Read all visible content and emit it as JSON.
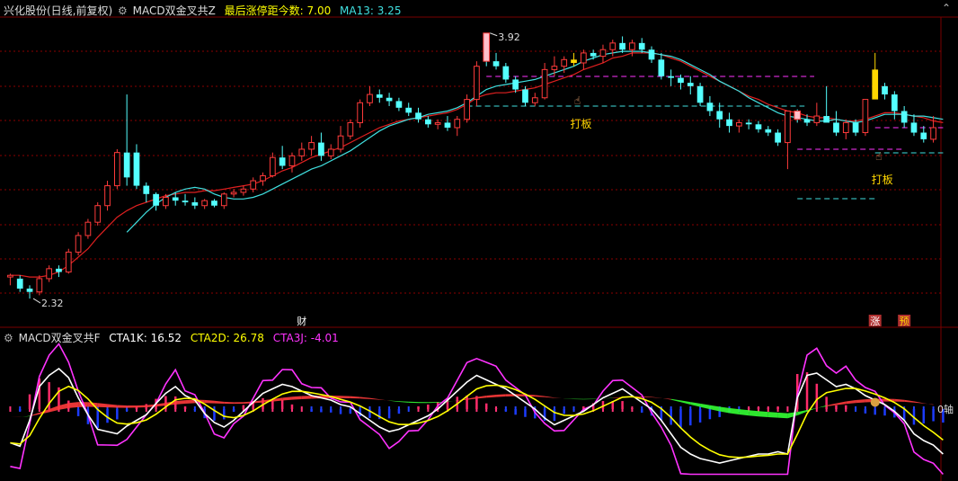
{
  "colors": {
    "up": "#ff3b3b",
    "down": "#54ffff",
    "limit_up": "#ffd700",
    "limit_fill": "#ffc0cb",
    "ma_red": "#e02020",
    "ma_cyan": "#40e0e0",
    "grid": "#8b0000",
    "magenta": "#ff33ff",
    "white": "#ffffff",
    "yellow": "#ffff00",
    "green": "#33ff33",
    "blue": "#1c3cff",
    "label": "#dddddd"
  },
  "header": {
    "stock": "兴化股份(日线,前复权)",
    "indicator": "MACD双金叉共Z",
    "info_label": "最后涨停距今数: 7.00",
    "ma_label": "MA13: 3.25"
  },
  "price_panel": {
    "high_label": "3.92",
    "low_label": "2.32",
    "annotations": [
      "打板",
      "打板"
    ],
    "markers": [
      "财",
      "涨",
      "预"
    ],
    "icons": [
      "hand-pointer-icon",
      "hand-pointer-icon",
      "up-arrow-icon"
    ]
  },
  "macd_header": {
    "name": "MACD双金叉共F",
    "cta1k": "CTA1K: 16.52",
    "cta2d": "CTA2D: 26.78",
    "cta3j": "CTA3J: -4.01",
    "zero_label": "0轴"
  },
  "chart_data": {
    "type": "candlestick",
    "ohlc": [
      [
        2.45,
        2.47,
        2.4,
        2.46
      ],
      [
        2.44,
        2.46,
        2.36,
        2.38
      ],
      [
        2.38,
        2.4,
        2.32,
        2.36
      ],
      [
        2.36,
        2.46,
        2.34,
        2.44
      ],
      [
        2.44,
        2.52,
        2.42,
        2.5
      ],
      [
        2.5,
        2.52,
        2.45,
        2.48
      ],
      [
        2.48,
        2.62,
        2.47,
        2.6
      ],
      [
        2.6,
        2.72,
        2.58,
        2.7
      ],
      [
        2.7,
        2.8,
        2.68,
        2.78
      ],
      [
        2.78,
        2.9,
        2.76,
        2.88
      ],
      [
        2.88,
        3.03,
        2.85,
        3.0
      ],
      [
        3.0,
        3.22,
        2.98,
        3.2
      ],
      [
        3.2,
        3.55,
        3.0,
        3.05
      ],
      [
        3.2,
        3.25,
        2.98,
        3.0
      ],
      [
        3.0,
        3.02,
        2.9,
        2.95
      ],
      [
        2.95,
        2.96,
        2.85,
        2.88
      ],
      [
        2.88,
        2.95,
        2.86,
        2.93
      ],
      [
        2.93,
        2.96,
        2.88,
        2.91
      ],
      [
        2.91,
        2.95,
        2.88,
        2.9
      ],
      [
        2.9,
        2.93,
        2.86,
        2.88
      ],
      [
        2.88,
        2.92,
        2.86,
        2.91
      ],
      [
        2.91,
        2.92,
        2.87,
        2.88
      ],
      [
        2.88,
        2.96,
        2.86,
        2.95
      ],
      [
        2.95,
        2.98,
        2.93,
        2.96
      ],
      [
        2.96,
        3.0,
        2.94,
        2.98
      ],
      [
        2.98,
        3.05,
        2.96,
        3.03
      ],
      [
        3.03,
        3.08,
        3.0,
        3.06
      ],
      [
        3.06,
        3.2,
        3.05,
        3.17
      ],
      [
        3.17,
        3.24,
        3.1,
        3.12
      ],
      [
        3.12,
        3.2,
        3.08,
        3.18
      ],
      [
        3.18,
        3.26,
        3.15,
        3.22
      ],
      [
        3.22,
        3.3,
        3.18,
        3.26
      ],
      [
        3.26,
        3.32,
        3.15,
        3.18
      ],
      [
        3.18,
        3.25,
        3.16,
        3.22
      ],
      [
        3.22,
        3.36,
        3.2,
        3.3
      ],
      [
        3.3,
        3.4,
        3.28,
        3.38
      ],
      [
        3.38,
        3.52,
        3.35,
        3.5
      ],
      [
        3.5,
        3.6,
        3.48,
        3.55
      ],
      [
        3.55,
        3.58,
        3.5,
        3.53
      ],
      [
        3.53,
        3.56,
        3.48,
        3.51
      ],
      [
        3.51,
        3.53,
        3.45,
        3.47
      ],
      [
        3.47,
        3.5,
        3.42,
        3.44
      ],
      [
        3.44,
        3.47,
        3.38,
        3.4
      ],
      [
        3.4,
        3.42,
        3.35,
        3.37
      ],
      [
        3.37,
        3.4,
        3.34,
        3.38
      ],
      [
        3.38,
        3.42,
        3.33,
        3.35
      ],
      [
        3.35,
        3.42,
        3.3,
        3.4
      ],
      [
        3.4,
        3.55,
        3.38,
        3.52
      ],
      [
        3.52,
        3.75,
        3.48,
        3.72
      ],
      [
        3.92,
        3.92,
        3.72,
        3.75
      ],
      [
        3.75,
        3.8,
        3.7,
        3.72
      ],
      [
        3.72,
        3.74,
        3.62,
        3.64
      ],
      [
        3.64,
        3.66,
        3.56,
        3.58
      ],
      [
        3.58,
        3.6,
        3.48,
        3.5
      ],
      [
        3.5,
        3.56,
        3.48,
        3.53
      ],
      [
        3.53,
        3.74,
        3.52,
        3.7
      ],
      [
        3.7,
        3.78,
        3.66,
        3.72
      ],
      [
        3.72,
        3.78,
        3.68,
        3.76
      ],
      [
        3.76,
        3.8,
        3.72,
        3.74
      ],
      [
        3.74,
        3.82,
        3.7,
        3.8
      ],
      [
        3.8,
        3.82,
        3.76,
        3.78
      ],
      [
        3.78,
        3.85,
        3.74,
        3.82
      ],
      [
        3.82,
        3.88,
        3.78,
        3.86
      ],
      [
        3.86,
        3.9,
        3.8,
        3.82
      ],
      [
        3.82,
        3.88,
        3.78,
        3.86
      ],
      [
        3.86,
        3.89,
        3.8,
        3.82
      ],
      [
        3.82,
        3.84,
        3.74,
        3.76
      ],
      [
        3.76,
        3.8,
        3.64,
        3.66
      ],
      [
        3.66,
        3.7,
        3.6,
        3.65
      ],
      [
        3.65,
        3.67,
        3.58,
        3.62
      ],
      [
        3.62,
        3.66,
        3.55,
        3.6
      ],
      [
        3.6,
        3.62,
        3.48,
        3.5
      ],
      [
        3.5,
        3.54,
        3.42,
        3.45
      ],
      [
        3.45,
        3.5,
        3.35,
        3.4
      ],
      [
        3.4,
        3.44,
        3.32,
        3.36
      ],
      [
        3.36,
        3.4,
        3.32,
        3.38
      ],
      [
        3.38,
        3.4,
        3.34,
        3.37
      ],
      [
        3.37,
        3.39,
        3.32,
        3.34
      ],
      [
        3.34,
        3.36,
        3.3,
        3.32
      ],
      [
        3.32,
        3.34,
        3.24,
        3.26
      ],
      [
        3.26,
        3.45,
        3.1,
        3.45
      ],
      [
        3.45,
        3.46,
        3.38,
        3.4
      ],
      [
        3.4,
        3.43,
        3.36,
        3.38
      ],
      [
        3.38,
        3.5,
        3.36,
        3.42
      ],
      [
        3.42,
        3.6,
        3.4,
        3.38
      ],
      [
        3.38,
        3.45,
        3.3,
        3.32
      ],
      [
        3.32,
        3.4,
        3.28,
        3.38
      ],
      [
        3.38,
        3.4,
        3.3,
        3.32
      ],
      [
        3.32,
        3.52,
        3.3,
        3.52
      ],
      [
        3.52,
        3.8,
        3.6,
        3.7
      ],
      [
        3.6,
        3.62,
        3.52,
        3.55
      ],
      [
        3.55,
        3.57,
        3.4,
        3.45
      ],
      [
        3.45,
        3.48,
        3.35,
        3.38
      ],
      [
        3.38,
        3.43,
        3.3,
        3.32
      ],
      [
        3.32,
        3.36,
        3.26,
        3.28
      ],
      [
        3.28,
        3.42,
        3.26,
        3.35
      ]
    ],
    "ma_red": [
      2.46,
      2.46,
      2.45,
      2.45,
      2.46,
      2.48,
      2.52,
      2.57,
      2.62,
      2.69,
      2.75,
      2.81,
      2.85,
      2.88,
      2.9,
      2.92,
      2.94,
      2.95,
      2.96,
      2.96,
      2.97,
      2.97,
      2.98,
      2.99,
      3.0,
      3.01,
      3.03,
      3.06,
      3.09,
      3.11,
      3.14,
      3.17,
      3.19,
      3.21,
      3.23,
      3.26,
      3.29,
      3.32,
      3.35,
      3.37,
      3.39,
      3.4,
      3.41,
      3.42,
      3.43,
      3.44,
      3.46,
      3.49,
      3.53,
      3.55,
      3.56,
      3.56,
      3.57,
      3.58,
      3.59,
      3.61,
      3.63,
      3.65,
      3.67,
      3.7,
      3.72,
      3.74,
      3.77,
      3.78,
      3.8,
      3.8,
      3.8,
      3.79,
      3.77,
      3.75,
      3.72,
      3.69,
      3.66,
      3.63,
      3.6,
      3.57,
      3.54,
      3.52,
      3.49,
      3.47,
      3.45,
      3.44,
      3.42,
      3.41,
      3.41,
      3.4,
      3.39,
      3.39,
      3.4,
      3.42,
      3.44,
      3.44,
      3.43,
      3.42,
      3.41,
      3.39,
      3.38
    ],
    "ma_cyan": [
      null,
      null,
      null,
      null,
      null,
      null,
      null,
      null,
      null,
      null,
      null,
      null,
      2.72,
      2.78,
      2.84,
      2.89,
      2.93,
      2.96,
      2.98,
      2.99,
      2.98,
      2.95,
      2.93,
      2.92,
      2.92,
      2.93,
      2.95,
      2.98,
      3.01,
      3.04,
      3.07,
      3.1,
      3.12,
      3.15,
      3.18,
      3.21,
      3.25,
      3.29,
      3.33,
      3.36,
      3.38,
      3.4,
      3.41,
      3.43,
      3.44,
      3.45,
      3.47,
      3.5,
      3.54,
      3.58,
      3.6,
      3.61,
      3.62,
      3.63,
      3.64,
      3.66,
      3.68,
      3.7,
      3.72,
      3.75,
      3.77,
      3.79,
      3.8,
      3.81,
      3.81,
      3.81,
      3.8,
      3.79,
      3.78,
      3.76,
      3.73,
      3.7,
      3.67,
      3.63,
      3.6,
      3.57,
      3.53,
      3.5,
      3.47,
      3.44,
      3.42,
      3.41,
      3.4,
      3.39,
      3.39,
      3.4,
      3.39,
      3.38,
      3.39,
      3.41,
      3.43,
      3.43,
      3.43,
      3.42,
      3.42,
      3.41,
      3.4
    ],
    "limit_up_index": [
      49,
      58,
      81,
      89
    ],
    "ylim": [
      2.25,
      4.0
    ],
    "macd": {
      "ylim": [
        -60,
        60
      ],
      "white": [
        -30,
        -33,
        -10,
        20,
        30,
        36,
        28,
        10,
        -5,
        -18,
        -20,
        -22,
        -15,
        -10,
        -5,
        5,
        14,
        20,
        12,
        8,
        -4,
        -12,
        -16,
        -10,
        -2,
        6,
        14,
        18,
        22,
        20,
        16,
        12,
        10,
        8,
        4,
        2,
        -4,
        -10,
        -16,
        -20,
        -18,
        -14,
        -10,
        -6,
        0,
        8,
        16,
        24,
        30,
        26,
        22,
        18,
        12,
        6,
        0,
        -8,
        -14,
        -10,
        -6,
        -2,
        4,
        10,
        14,
        18,
        12,
        6,
        0,
        -10,
        -22,
        -34,
        -40,
        -44,
        -46,
        -48,
        -46,
        -44,
        -42,
        -40,
        -40,
        -38,
        -40,
        10,
        30,
        32,
        26,
        20,
        22,
        18,
        12,
        8,
        4,
        -2,
        -10,
        -22,
        -28,
        -32,
        -40
      ]
    }
  }
}
